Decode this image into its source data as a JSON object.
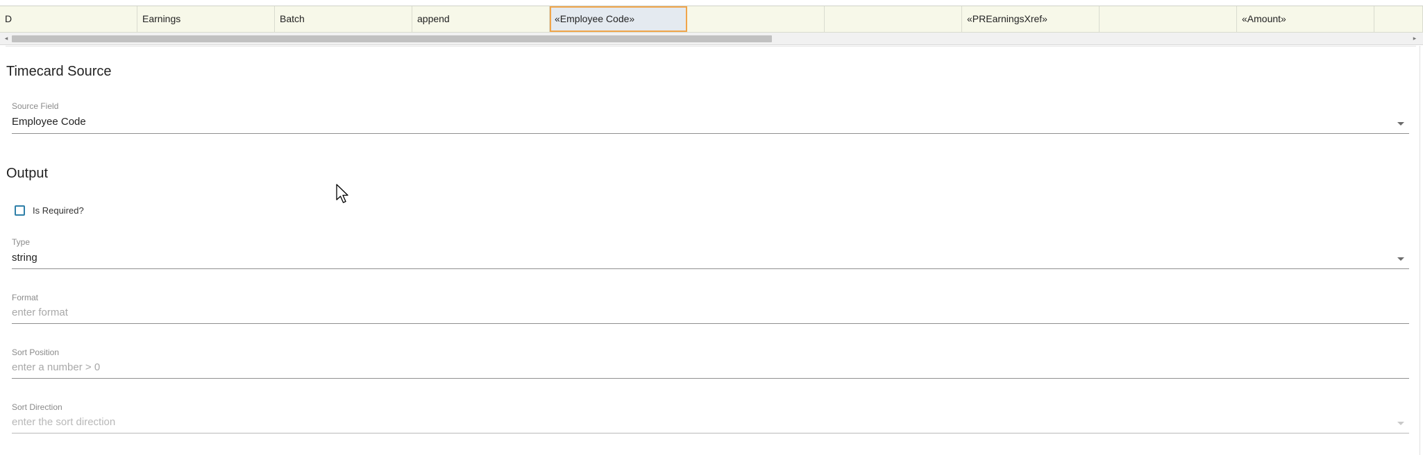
{
  "grid": {
    "cells": [
      "D",
      "Earnings",
      "Batch",
      "append",
      "«Employee Code»",
      "",
      "",
      "«PREarningsXref»",
      "",
      "«Amount»",
      ""
    ],
    "selected_index": 4,
    "scroll_left_arrow": "◂",
    "scroll_right_arrow": "▸"
  },
  "timecard_source": {
    "title": "Timecard Source",
    "source_field": {
      "label": "Source Field",
      "value": "Employee Code"
    }
  },
  "output": {
    "title": "Output",
    "is_required": {
      "label": "Is Required?",
      "checked": false
    },
    "type": {
      "label": "Type",
      "value": "string"
    },
    "format": {
      "label": "Format",
      "placeholder": "enter format",
      "value": ""
    },
    "sort_position": {
      "label": "Sort Position",
      "placeholder": "enter a number > 0",
      "value": ""
    },
    "sort_direction": {
      "label": "Sort Direction",
      "placeholder": "enter the sort direction"
    }
  },
  "icons": {
    "dropdown": "chevron-down-icon",
    "cursor": "mouse-pointer-icon"
  },
  "colors": {
    "row_background": "#f7f8e9",
    "selected_border": "#f0a54a",
    "selected_background": "#e4eaf0",
    "checkbox_border": "#2e7fa8"
  }
}
